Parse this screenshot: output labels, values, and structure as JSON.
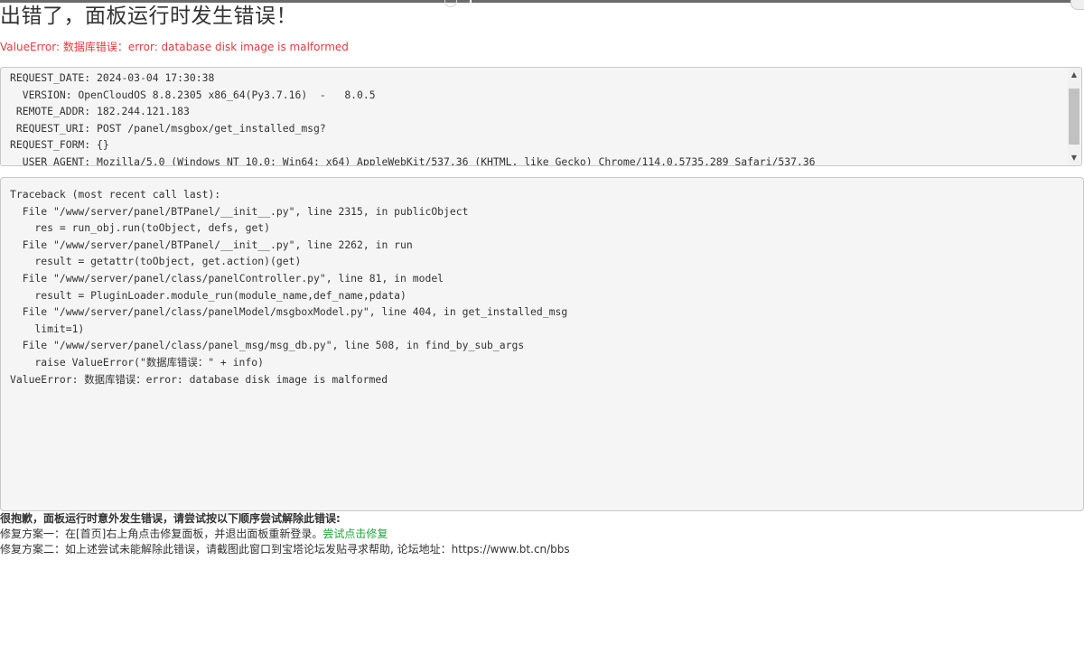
{
  "page": {
    "title": "出错了，面板运行时发生错误！",
    "error_message": "ValueError: 数据库错误：error: database disk image is malformed"
  },
  "request_info": {
    "lines": [
      "REQUEST_DATE: 2024-03-04 17:30:38",
      "  VERSION: OpenCloudOS 8.8.2305 x86_64(Py3.7.16)  -   8.0.5",
      " REMOTE_ADDR: 182.244.121.183",
      " REQUEST_URI: POST /panel/msgbox/get_installed_msg?",
      "REQUEST_FORM: {}",
      "  USER_AGENT: Mozilla/5.0 (Windows NT 10.0; Win64; x64) AppleWebKit/537.36 (KHTML, like Gecko) Chrome/114.0.5735.289 Safari/537.36"
    ],
    "scroll_up_icon": "▲",
    "scroll_down_icon": "▼"
  },
  "traceback": {
    "lines": [
      "Traceback (most recent call last):",
      "  File \"/www/server/panel/BTPanel/__init__.py\", line 2315, in publicObject",
      "    res = run_obj.run(toObject, defs, get)",
      "  File \"/www/server/panel/BTPanel/__init__.py\", line 2262, in run",
      "    result = getattr(toObject, get.action)(get)",
      "  File \"/www/server/panel/class/panelController.py\", line 81, in model",
      "    result = PluginLoader.module_run(module_name,def_name,pdata)",
      "  File \"/www/server/panel/class/panelModel/msgboxModel.py\", line 404, in get_installed_msg",
      "    limit=1)",
      "  File \"/www/server/panel/class/panel_msg/msg_db.py\", line 508, in find_by_sub_args",
      "    raise ValueError(\"数据库错误：\" + info)",
      "ValueError: 数据库错误：error: database disk image is malformed"
    ]
  },
  "help": {
    "title": "很抱歉，面板运行时意外发生错误，请尝试按以下顺序尝试解除此错误:",
    "fix1_text": "修复方案一：在[首页]右上角点击修复面板，并退出面板重新登录。",
    "fix1_link": "尝试点击修复",
    "fix2_text": "修复方案二：如上述尝试未能解除此错误，请截图此窗口到宝塔论坛发贴寻求帮助, 论坛地址：https://www.bt.cn/bbs"
  },
  "colors": {
    "error_text": "#e4393c",
    "link_green": "#20a53a",
    "code_background": "#f5f5f5"
  }
}
